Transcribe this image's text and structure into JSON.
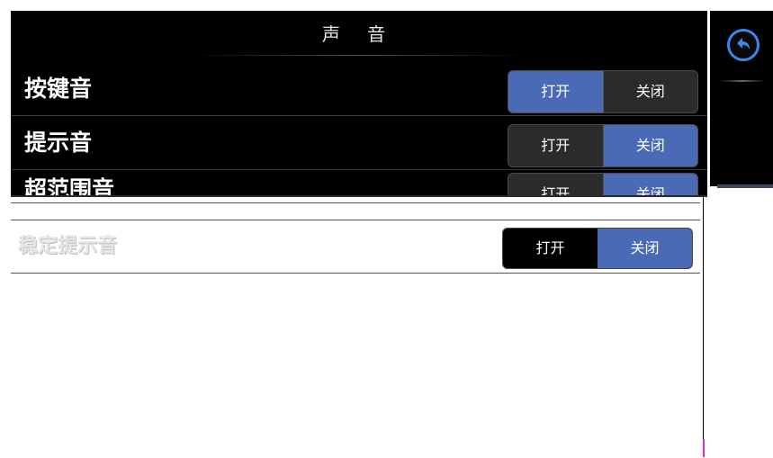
{
  "header": {
    "title": "声 音"
  },
  "rows": [
    {
      "label": "按键音",
      "on_label": "打开",
      "off_label": "关闭",
      "selected": "on"
    },
    {
      "label": "提示音",
      "on_label": "打开",
      "off_label": "关闭",
      "selected": "off"
    },
    {
      "label": "超范围音",
      "on_label": "打开",
      "off_label": "关闭",
      "selected": "off"
    },
    {
      "label": "稳定提示音",
      "on_label": "打开",
      "off_label": "关闭",
      "selected": "off"
    }
  ],
  "sidebar": {
    "back_icon": "back-arrow-icon",
    "accent": "#3b86e8"
  },
  "colors": {
    "selected": "#4a6ab5",
    "panel_bg": "#000000"
  }
}
